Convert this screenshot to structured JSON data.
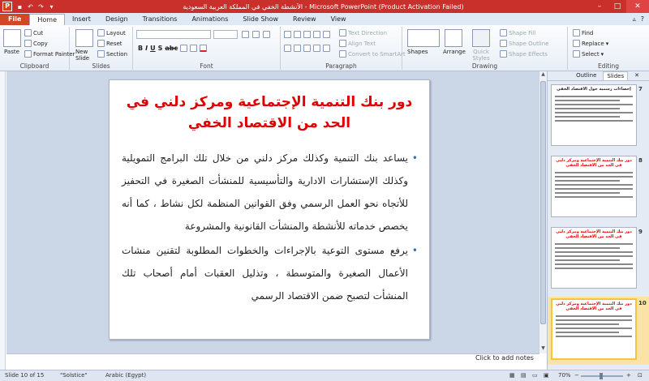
{
  "window": {
    "title": "الأنشطة الخفي في المملكة العربية السعودية - Microsoft PowerPoint (Product Activation Failed)",
    "app_icon": "P"
  },
  "tabs": [
    "File",
    "Home",
    "Insert",
    "Design",
    "Transitions",
    "Animations",
    "Slide Show",
    "Review",
    "View"
  ],
  "ribbon": {
    "clipboard": {
      "label": "Clipboard",
      "paste": "Paste",
      "cut": "Cut",
      "copy": "Copy",
      "format_painter": "Format Painter"
    },
    "slides": {
      "label": "Slides",
      "new_slide": "New Slide",
      "layout": "Layout",
      "reset": "Reset",
      "section": "Section"
    },
    "font": {
      "label": "Font"
    },
    "paragraph": {
      "label": "Paragraph",
      "text_direction": "Text Direction",
      "align_text": "Align Text",
      "convert_smartart": "Convert to SmartArt"
    },
    "drawing": {
      "label": "Drawing",
      "shapes": "Shapes",
      "arrange": "Arrange",
      "quick_styles": "Quick Styles",
      "shape_fill": "Shape Fill",
      "shape_outline": "Shape Outline",
      "shape_effects": "Shape Effects"
    },
    "editing": {
      "label": "Editing",
      "find": "Find",
      "replace": "Replace",
      "select": "Select"
    }
  },
  "slide": {
    "title": "دور بنك التنمية الإجتماعية ومركز دلني في الحد من الاقتصاد الخفي",
    "bullets": [
      "يساعد بنك التنمية وكذلك مركز دلني من خلال تلك البرامج التمويلية وكذلك الإستشارات الادارية والتأسيسية للمنشأت الصغيرة في التحفيز للأتجاه نحو العمل الرسمي وفق القوانين المنظمة لكل نشاط ، كما أنه يخصص خدماته للأنشطة والمنشأت القانونية والمشروعة",
      "يرفع مستوى التوعية بالإجراءات والخطوات المطلوبة لتقنين منشات الأعمال الصغيرة والمتوسطة ، وتذليل العقبات أمام أصحاب تلك المنشأت لتصبح ضمن الاقتصاد الرسمي"
    ]
  },
  "notes_placeholder": "Click to add notes",
  "panel": {
    "tabs": [
      "Outline",
      "Slides"
    ],
    "thumbs": [
      {
        "num": "7",
        "title": "إحصاءات رسمية حول الاقتصاد الخفي",
        "title_black": true
      },
      {
        "num": "8",
        "title": "دور بنك التنمية الإجتماعية ومركز دلني في الحد من الاقتصاد الخفي",
        "title_black": false
      },
      {
        "num": "9",
        "title": "دور بنك التنمية الإجتماعية ومركز دلني في الحد من الاقتصاد الخفي",
        "title_black": false
      },
      {
        "num": "10",
        "title": "دور بنك التنمية الإجتماعية ومركز دلني في الحد من الاقتصاد الخفي",
        "title_black": false
      }
    ]
  },
  "status": {
    "slide": "Slide 10 of 15",
    "theme": "\"Solstice\"",
    "language": "Arabic (Egypt)",
    "zoom": "70%"
  }
}
